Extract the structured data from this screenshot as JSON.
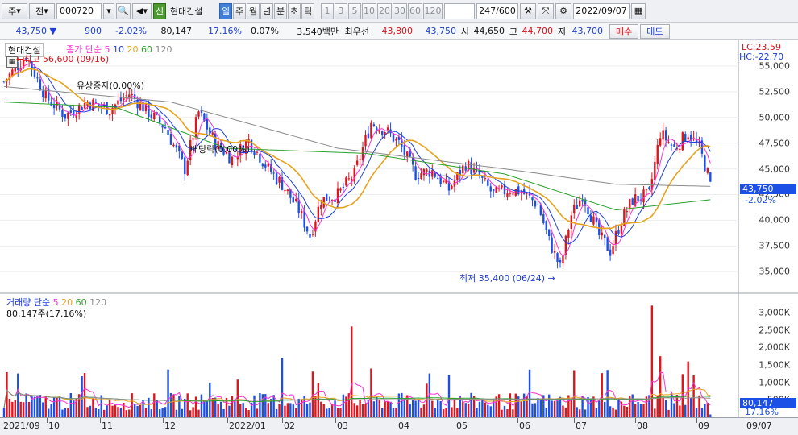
{
  "toolbar": {
    "market": "주",
    "type": "전",
    "code": "000720",
    "credit_badge": "신",
    "name": "현대건설",
    "periods": [
      "일",
      "주",
      "월",
      "년",
      "분",
      "초",
      "틱"
    ],
    "selected_period": "일",
    "nums": [
      "1",
      "3",
      "5",
      "10",
      "20",
      "30",
      "60",
      "120"
    ],
    "count": "247/600",
    "date": "2022/09/07"
  },
  "quote": {
    "price": "43,750",
    "change": "900",
    "pct": "-2.02%",
    "volume": "80,147",
    "vol_ratio": "17.16%",
    "turnover": "0.07%",
    "amount": "3,540백만",
    "best_label": "최우선",
    "ask": "43,800",
    "bid": "43,750",
    "open_label": "시",
    "open": "44,650",
    "high_label": "고",
    "high": "44,700",
    "low_label": "저",
    "low": "43,700",
    "buy": "매수",
    "sell": "매도"
  },
  "price_panel": {
    "tag": "현대건설",
    "legend": {
      "label": "종가 단순",
      "ma": [
        "5",
        "10",
        "20",
        "60",
        "120"
      ]
    },
    "lc": "LC:23.59",
    "hc": "HC:-22.70",
    "yticks": [
      "55,000",
      "52,500",
      "50,000",
      "47,500",
      "45,000",
      "42,500",
      "40,000",
      "37,500",
      "35,000"
    ],
    "last_price": "43,750",
    "last_pct": "-2.02%",
    "high_note": "최고 56,600 (09/16)",
    "low_note": "최저 35,400 (06/24)",
    "event1": "유상증자(0.00%)",
    "event2": "배당락(0.00%)"
  },
  "volume_panel": {
    "legend_label": "거래량 단순",
    "ma": [
      "5",
      "20",
      "60",
      "120"
    ],
    "sub": "80,147주(17.16%)",
    "yticks": [
      "3,000K",
      "2,500K",
      "2,000K",
      "1,500K",
      "1,000K",
      "500K"
    ],
    "last_vol": "80,147",
    "last_pct": "17.16%"
  },
  "xaxis": [
    "2021/09",
    "10",
    "11",
    "12",
    "2022/01",
    "02",
    "03",
    "04",
    "05",
    "06",
    "07",
    "08",
    "09",
    "09/07"
  ],
  "colors": {
    "up": "#e0141c",
    "down": "#1c4fe6",
    "ma5": "#ff2fd0",
    "ma10": "#1c3fe0",
    "ma20": "#e6a21a",
    "ma60": "#2aa02a",
    "ma120": "#8a8a8a"
  },
  "chart_data": {
    "type": "candlestick",
    "ylim": [
      34000,
      57500
    ],
    "anchors": [
      [
        0,
        53500
      ],
      [
        8,
        56000
      ],
      [
        15,
        52000
      ],
      [
        22,
        50200
      ],
      [
        30,
        51500
      ],
      [
        38,
        50800
      ],
      [
        45,
        52300
      ],
      [
        52,
        50500
      ],
      [
        58,
        49000
      ],
      [
        65,
        45000
      ],
      [
        70,
        50500
      ],
      [
        76,
        47500
      ],
      [
        82,
        46000
      ],
      [
        88,
        47800
      ],
      [
        95,
        45000
      ],
      [
        100,
        43500
      ],
      [
        106,
        41000
      ],
      [
        110,
        38500
      ],
      [
        114,
        42000
      ],
      [
        120,
        42500
      ],
      [
        126,
        44500
      ],
      [
        132,
        49500
      ],
      [
        137,
        48800
      ],
      [
        142,
        47500
      ],
      [
        148,
        44500
      ],
      [
        154,
        44800
      ],
      [
        160,
        43000
      ],
      [
        166,
        45500
      ],
      [
        170,
        44500
      ],
      [
        176,
        42500
      ],
      [
        182,
        43000
      ],
      [
        186,
        42800
      ],
      [
        192,
        41500
      ],
      [
        196,
        38000
      ],
      [
        200,
        35400
      ],
      [
        204,
        40500
      ],
      [
        208,
        42500
      ],
      [
        214,
        38500
      ],
      [
        218,
        37000
      ],
      [
        222,
        40000
      ],
      [
        226,
        42000
      ],
      [
        232,
        42500
      ],
      [
        236,
        48500
      ],
      [
        241,
        47000
      ],
      [
        246,
        48500
      ],
      [
        250,
        47000
      ],
      [
        254,
        43750
      ]
    ],
    "ma_ratios": {
      "ma60": [
        [
          0,
          51500
        ],
        [
          40,
          51000
        ],
        [
          80,
          47000
        ],
        [
          130,
          46500
        ],
        [
          180,
          44500
        ],
        [
          220,
          41000
        ],
        [
          254,
          42000
        ]
      ],
      "ma120": [
        [
          0,
          53000
        ],
        [
          60,
          51500
        ],
        [
          120,
          47000
        ],
        [
          180,
          45000
        ],
        [
          220,
          43500
        ],
        [
          254,
          43300
        ]
      ]
    }
  }
}
